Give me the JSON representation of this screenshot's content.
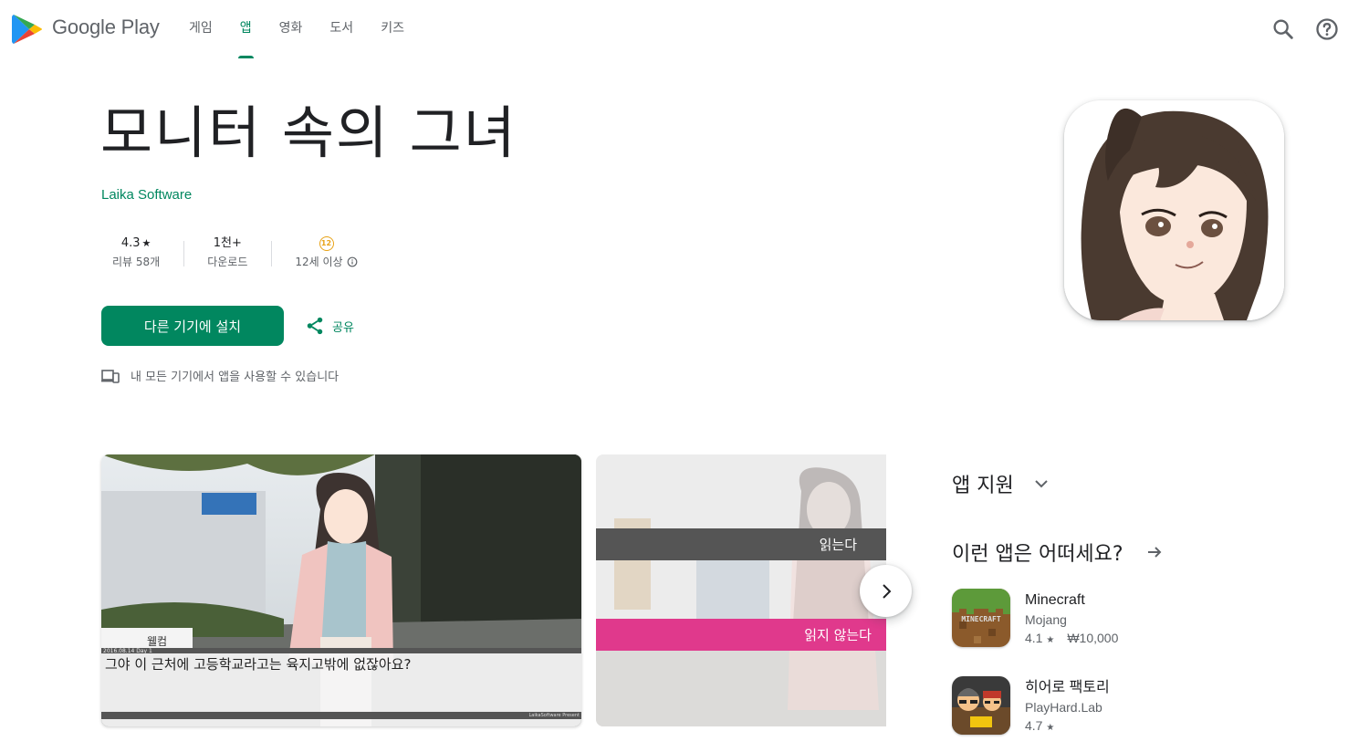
{
  "header": {
    "brand": "Google Play",
    "tabs": [
      {
        "label": "게임",
        "active": false
      },
      {
        "label": "앱",
        "active": true
      },
      {
        "label": "영화",
        "active": false
      },
      {
        "label": "도서",
        "active": false
      },
      {
        "label": "키즈",
        "active": false
      }
    ],
    "icons": [
      "search-icon",
      "help-icon"
    ]
  },
  "app": {
    "title": "모니터 속의 그녀",
    "developer": "Laika Software",
    "rating": "4.3",
    "rating_star": "★",
    "reviews": "리뷰 58개",
    "downloads": "1천+",
    "downloads_label": "다운로드",
    "age_badge": "12",
    "age_label": "12세 이상",
    "install_label": "다른 기기에 설치",
    "share_label": "공유",
    "devices_note": "내 모든 기기에서 앱을 사용할 수 있습니다"
  },
  "screenshots": {
    "shot1": {
      "speaker": "웰컴",
      "status_line": "2016.08.14 Day 1",
      "dialogue": "그야 이 근처에 고등학교라고는 육지고밖에 없잖아요?",
      "credit": "LaikaSoftware Present"
    },
    "shot2": {
      "choice1": "읽는다",
      "choice2": "읽지 않는다"
    }
  },
  "sidebar": {
    "support_label": "앱 지원",
    "similar_label": "이런 앱은 어떠세요?",
    "similar_apps": [
      {
        "name": "Minecraft",
        "developer": "Mojang",
        "rating": "4.1",
        "star": "★",
        "price": "₩10,000",
        "icon_text": "MINECRAFT"
      },
      {
        "name": "히어로 팩토리",
        "developer": "PlayHard.Lab",
        "rating": "4.7",
        "star": "★",
        "price": ""
      }
    ]
  },
  "colors": {
    "accent": "#01875f",
    "text": "#202124",
    "muted": "#5f6368",
    "choice_gray": "#555555",
    "choice_pink": "#e0398c"
  }
}
